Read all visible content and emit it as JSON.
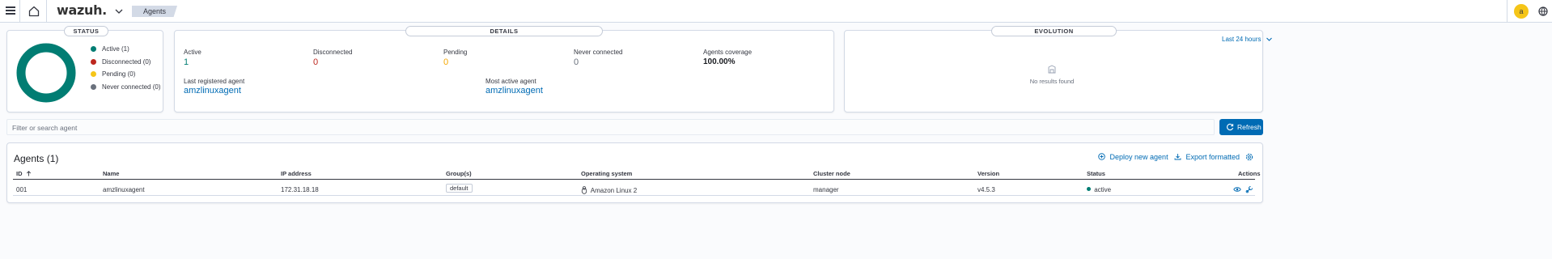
{
  "header": {
    "logo_text": "wazuh.",
    "breadcrumb": "Agents",
    "avatar_letter": "a"
  },
  "status_panel": {
    "title": "STATUS",
    "legend": [
      {
        "label": "Active (1)",
        "color": "#017d73"
      },
      {
        "label": "Disconnected (0)",
        "color": "#bd271e"
      },
      {
        "label": "Pending (0)",
        "color": "#f5a700"
      },
      {
        "label": "Never connected (0)",
        "color": "#6a717d"
      }
    ],
    "donut_color": "#017d73"
  },
  "details_panel": {
    "title": "DETAILS",
    "stats": [
      {
        "label": "Active",
        "value": "1",
        "color": "#017d73"
      },
      {
        "label": "Disconnected",
        "value": "0",
        "color": "#bd271e"
      },
      {
        "label": "Pending",
        "value": "0",
        "color": "#f5a700"
      },
      {
        "label": "Never connected",
        "value": "0",
        "color": "#6a717d"
      },
      {
        "label": "Agents coverage",
        "value": "100.00%",
        "color": "#343741"
      }
    ],
    "last_registered_label": "Last registered agent",
    "last_registered_value": "amzlinuxagent",
    "most_active_label": "Most active agent",
    "most_active_value": "amzlinuxagent"
  },
  "evolution_panel": {
    "title": "EVOLUTION",
    "range": "Last 24 hours",
    "empty_text": "No results found"
  },
  "search": {
    "placeholder": "Filter or search agent",
    "refresh_label": "Refresh"
  },
  "agents_table": {
    "title": "Agents (1)",
    "deploy_label": "Deploy new agent",
    "export_label": "Export formatted",
    "columns": [
      "ID",
      "Name",
      "IP address",
      "Group(s)",
      "Operating system",
      "Cluster node",
      "Version",
      "Status",
      "Actions"
    ],
    "rows": [
      {
        "id": "001",
        "name": "amzlinuxagent",
        "ip": "172.31.18.18",
        "group": "default",
        "os": "Amazon Linux 2",
        "cluster_node": "manager",
        "version": "v4.5.3",
        "status": "active"
      }
    ]
  },
  "colors": {
    "accent": "#006bb4",
    "active": "#017d73"
  }
}
